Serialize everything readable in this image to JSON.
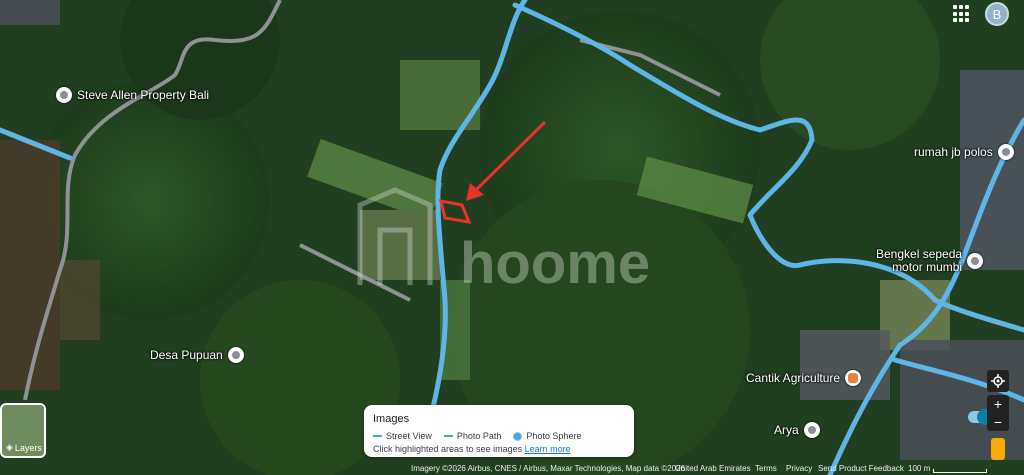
{
  "map": {
    "watermark": "hoome",
    "colors": {
      "road": "#5fb6e6",
      "marker": "#e8322b",
      "forest": "#1f3a1e"
    }
  },
  "places": [
    {
      "id": "steve-allen",
      "label": "Steve Allen Property Bali",
      "icon": "place-pin-icon"
    },
    {
      "id": "rumah-jb-polos",
      "label": "rumah jb polos",
      "icon": "place-pin-icon"
    },
    {
      "id": "bengkel-line1",
      "label": "Bengkel sepeda"
    },
    {
      "id": "bengkel-line2",
      "label": "motor mumbi",
      "icon": "place-pin-icon"
    },
    {
      "id": "desa-pupuan",
      "label": "Desa Pupuan",
      "icon": "place-pin-icon"
    },
    {
      "id": "cantik-agriculture",
      "label": "Cantik Agriculture",
      "icon": "shop-icon"
    },
    {
      "id": "arya",
      "label": "Arya",
      "icon": "place-pin-icon"
    }
  ],
  "account": {
    "initial": "B"
  },
  "layers": {
    "label": "Layers"
  },
  "images_panel": {
    "title": "Images",
    "street_view": "Street View",
    "photo_path": "Photo Path",
    "photo_sphere": "Photo Sphere",
    "hint": "Click highlighted areas to see images",
    "learn_more": "Learn more",
    "toggle_on": true
  },
  "controls": {
    "zoom_in": "+",
    "zoom_out": "−"
  },
  "footer": {
    "attribution": "Imagery ©2026 Airbus, CNES / Airbus, Maxar Technologies, Map data ©2026",
    "region": "United Arab Emirates",
    "terms": "Terms",
    "privacy": "Privacy",
    "feedback": "Send Product Feedback",
    "scale": "100 m"
  }
}
